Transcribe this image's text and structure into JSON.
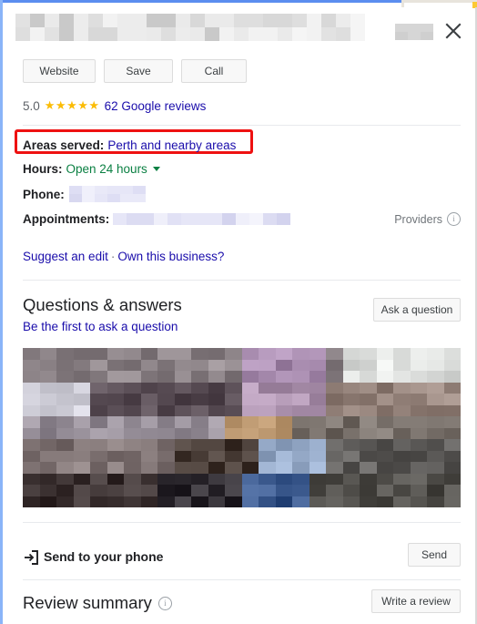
{
  "panel": {
    "accent_blue": "#5b8def",
    "focus_ring": "#8ab4f8",
    "highlight_color": "#ee1111",
    "link_color": "#1a0dab",
    "star_color": "#fbbc04",
    "hours_color": "#0b8043"
  },
  "header": {
    "title_redacted": true,
    "subtitle_redacted": true,
    "close_label": "Close"
  },
  "actions": {
    "website_label": "Website",
    "save_label": "Save",
    "call_label": "Call"
  },
  "rating": {
    "score": "5.0",
    "stars": "★★★★★",
    "star_count": 5,
    "reviews_text": "62 Google reviews",
    "review_count": 62
  },
  "details": {
    "areas_served_label": "Areas served:",
    "areas_served_value": "Perth and nearby areas",
    "hours_label": "Hours:",
    "hours_value": "Open 24 hours",
    "phone_label": "Phone:",
    "phone_value_redacted": true,
    "appointments_label": "Appointments:",
    "appointments_value_redacted": true,
    "providers_label": "Providers"
  },
  "suggest": {
    "edit_label": "Suggest an edit",
    "separator": "·",
    "own_label": "Own this business?"
  },
  "questions": {
    "title": "Questions & answers",
    "subtitle": "Be the first to ask a question",
    "ask_button_label": "Ask a question"
  },
  "send_phone": {
    "label": "Send to your phone",
    "button_label": "Send"
  },
  "review_summary": {
    "title": "Review summary",
    "button_label": "Write a review"
  },
  "icons": {
    "close": "close-icon",
    "caret": "chevron-down-icon",
    "info": "info-icon",
    "send_phone": "send-to-phone-icon"
  }
}
